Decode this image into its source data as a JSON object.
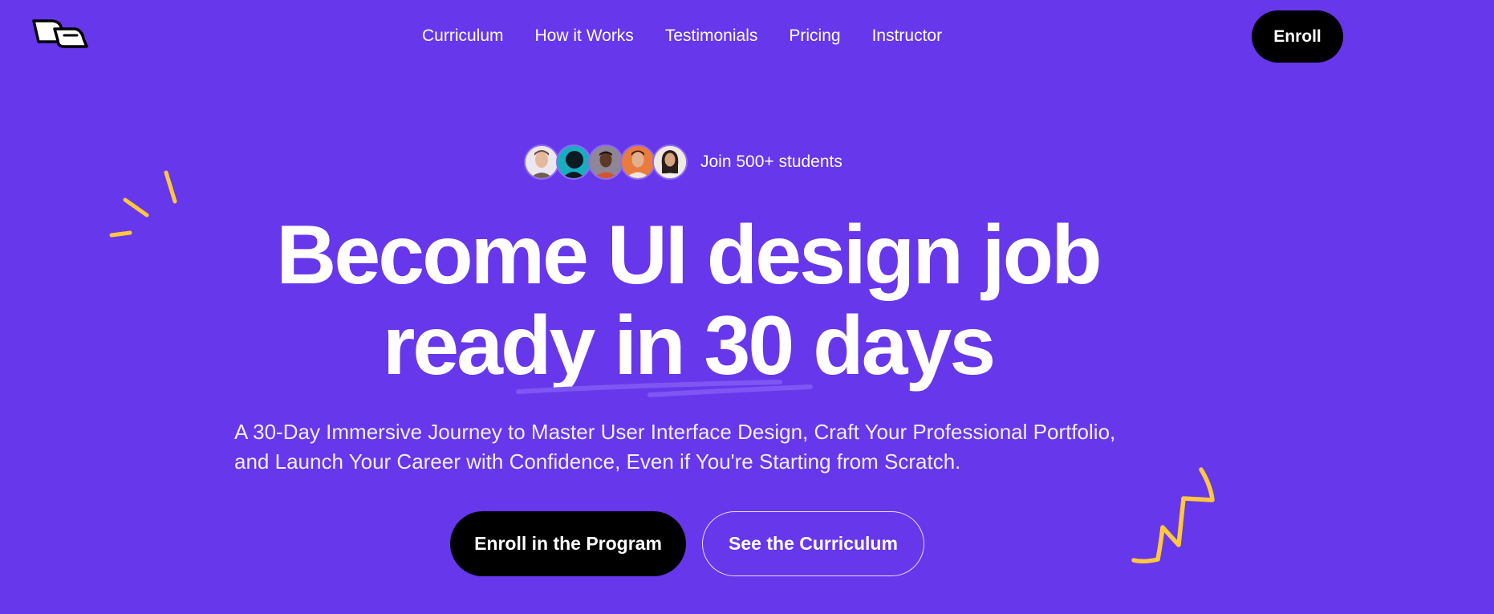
{
  "brand": {
    "logo_icon": "dc-logo-icon"
  },
  "nav": {
    "items": [
      {
        "label": "Curriculum"
      },
      {
        "label": "How it Works"
      },
      {
        "label": "Testimonials"
      },
      {
        "label": "Pricing"
      },
      {
        "label": "Instructor"
      }
    ],
    "enroll_label": "Enroll"
  },
  "hero": {
    "social_proof_text": "Join 500+ students",
    "avatar_count": 5,
    "headline_line1": "Become UI design job",
    "headline_line2": "ready in 30 days",
    "subtitle_line1": "A 30-Day Immersive Journey to Master User Interface Design, Craft Your Professional Portfolio,",
    "subtitle_line2": "and Launch Your Career with Confidence, Even if You're Starting from Scratch.",
    "primary_cta": "Enroll in the Program",
    "secondary_cta": "See the Curriculum"
  },
  "colors": {
    "background": "#6737EC",
    "accent_yellow": "#FFC83A",
    "button_dark": "#000000",
    "text": "#FFFFFF"
  },
  "decorations": {
    "sparkle_icon": "sparkle-doodle-icon",
    "zigzag_icon": "zigzag-doodle-icon"
  }
}
